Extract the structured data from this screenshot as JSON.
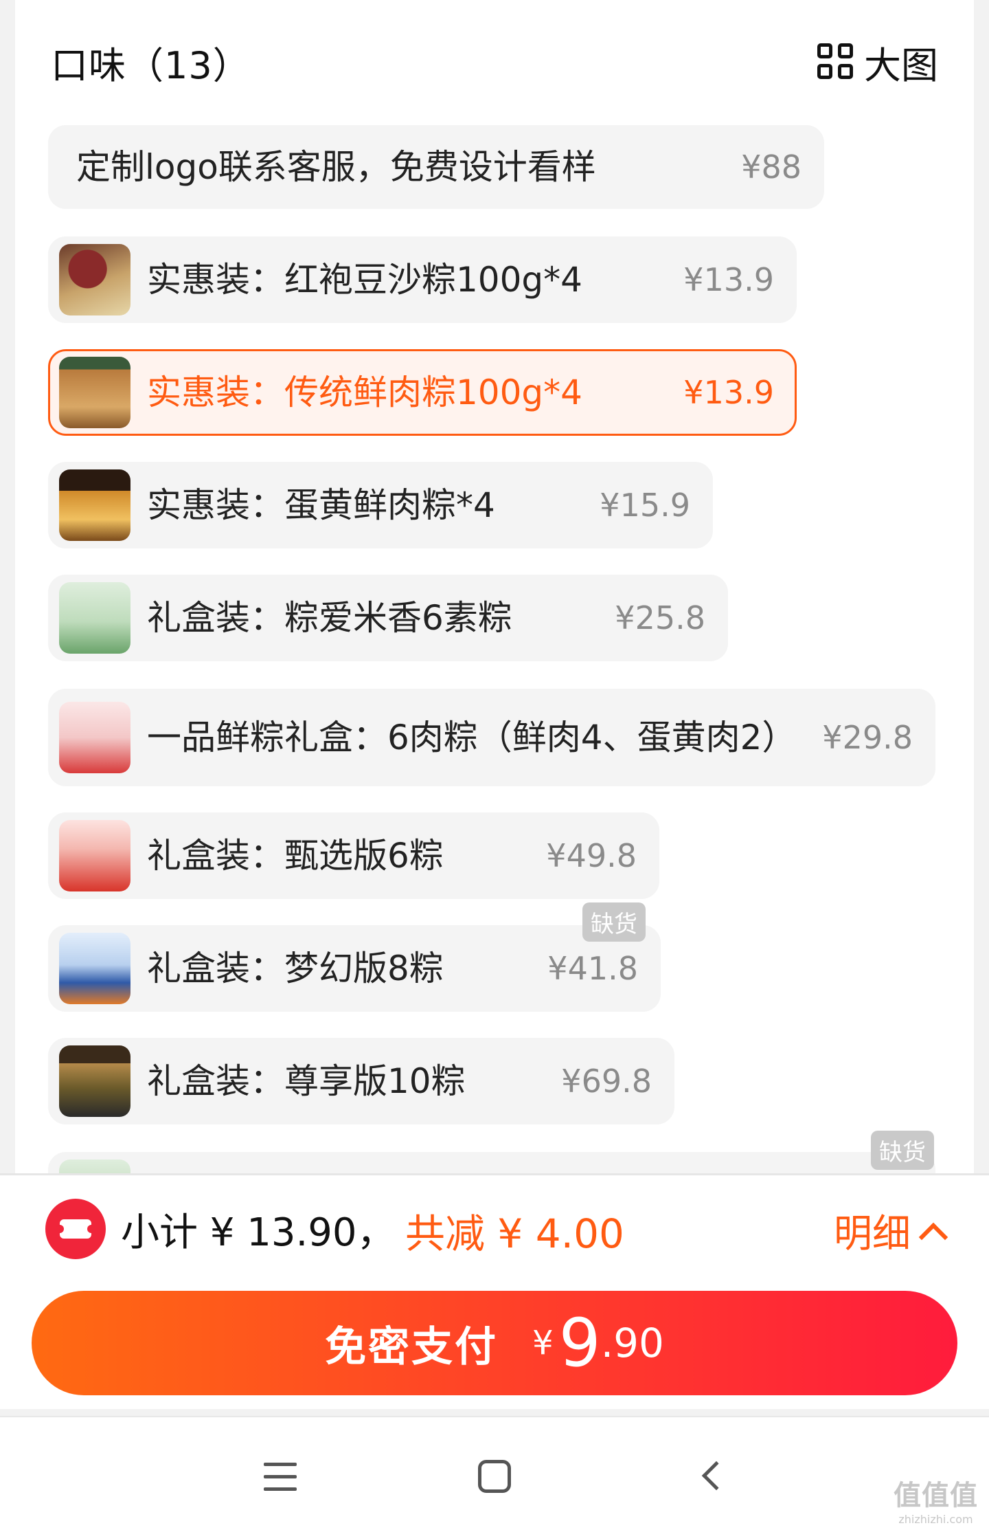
{
  "header": {
    "title": "口味（13）",
    "view_toggle_label": "大图"
  },
  "options": [
    {
      "name": "定制logo联系客服，免费设计看样",
      "price": "¥88",
      "selected": false
    },
    {
      "name": "实惠装：红袍豆沙粽100g*4",
      "price": "¥13.9",
      "selected": false
    },
    {
      "name": "实惠装：传统鲜肉粽100g*4",
      "price": "¥13.9",
      "selected": true
    },
    {
      "name": "实惠装：蛋黄鲜肉粽*4",
      "price": "¥15.9",
      "selected": false
    },
    {
      "name": "礼盒装：粽爱米香6素粽",
      "price": "¥25.8",
      "selected": false
    },
    {
      "name": "一品鲜粽礼盒：6肉粽（鲜肉4、蛋黄肉2）",
      "price": "¥29.8",
      "selected": false
    },
    {
      "name": "礼盒装：甄选版6粽",
      "price": "¥49.8",
      "selected": false
    },
    {
      "name": "礼盒装：梦幻版8粽",
      "price": "¥41.8",
      "selected": false
    },
    {
      "name": "礼盒装：尊享版10粽",
      "price": "¥69.8",
      "selected": false
    }
  ],
  "badges": {
    "out_of_stock_1": "缺货",
    "out_of_stock_2": "缺货"
  },
  "summary": {
    "subtotal": "小计 ¥ 13.90，",
    "discount": "共减 ¥ 4.00",
    "detail_label": "明细"
  },
  "pay_button": {
    "label": "免密支付",
    "currency": "¥",
    "amount_int": "9",
    "amount_dec": ".90"
  },
  "watermark": {
    "main": "值值值",
    "sub": "zhizhizhi.com"
  },
  "colors": {
    "accent": "#ff5b12",
    "pay_gradient_start": "#ff6a12",
    "pay_gradient_end": "#ff1c3c",
    "coupon": "#f0253a"
  }
}
